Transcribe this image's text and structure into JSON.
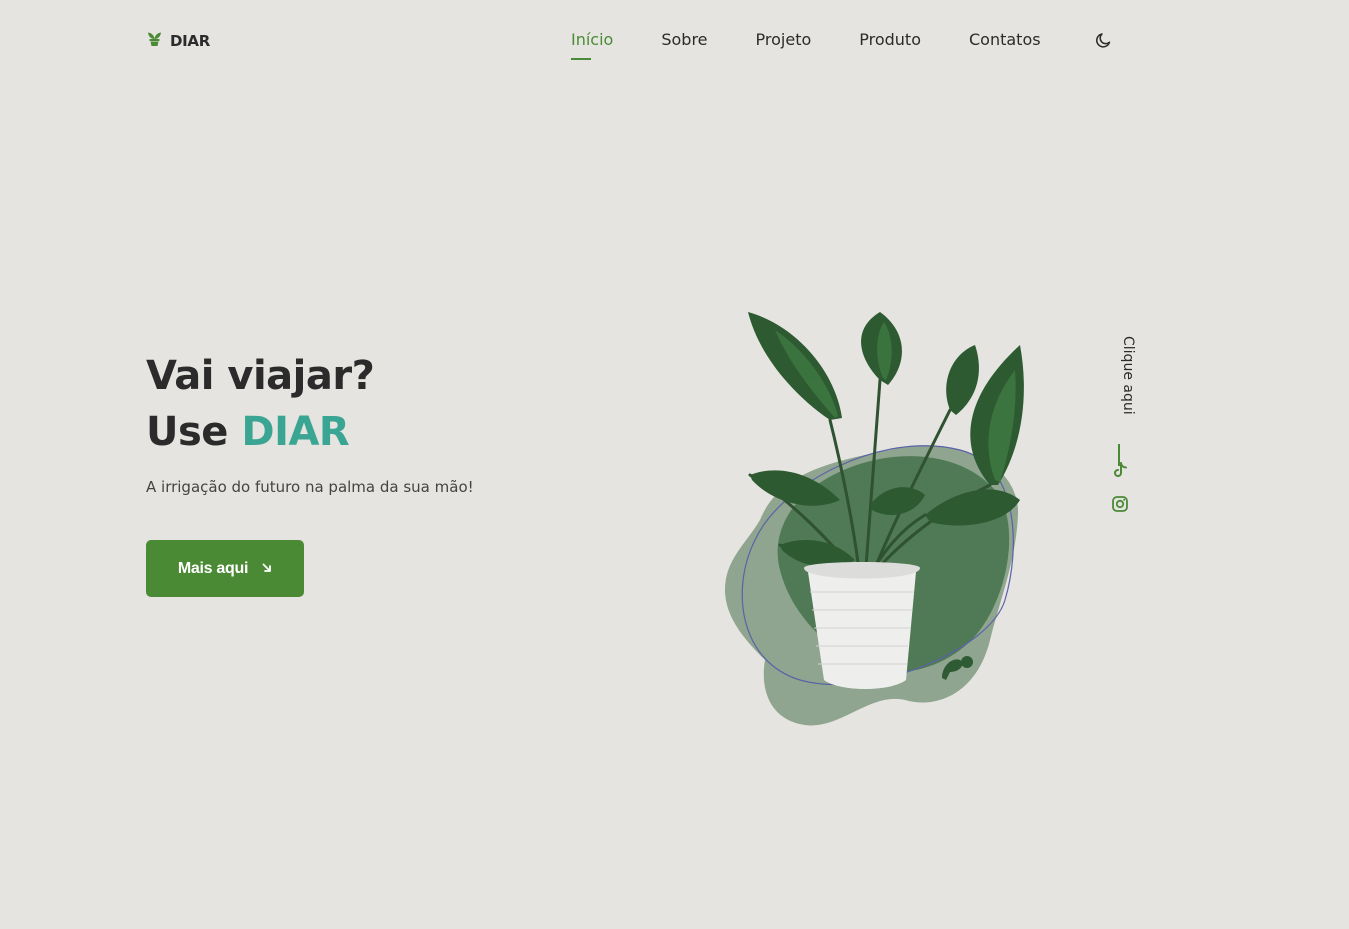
{
  "brand": {
    "name": "DIAR",
    "logo_icon": "plant-pot-icon"
  },
  "nav": {
    "items": [
      {
        "label": "Início",
        "active": true
      },
      {
        "label": "Sobre",
        "active": false
      },
      {
        "label": "Projeto",
        "active": false
      },
      {
        "label": "Produto",
        "active": false
      },
      {
        "label": "Contatos",
        "active": false
      }
    ],
    "theme_icon": "moon-icon"
  },
  "hero": {
    "title_line1": "Vai viajar?",
    "title_line2_prefix": "Use",
    "title_line2_brand": "DIAR",
    "subtitle": "A irrigação do futuro na palma da sua mão!",
    "cta_label": "Mais aqui",
    "cta_icon": "arrow-down-right-icon"
  },
  "social": {
    "label": "Clique aqui",
    "icons": [
      "tiktok-icon",
      "instagram-icon"
    ]
  },
  "colors": {
    "background": "#e5e4e0",
    "accent": "#4a8a35",
    "brand_teal": "#3aa592",
    "text": "#2b2b2b"
  }
}
